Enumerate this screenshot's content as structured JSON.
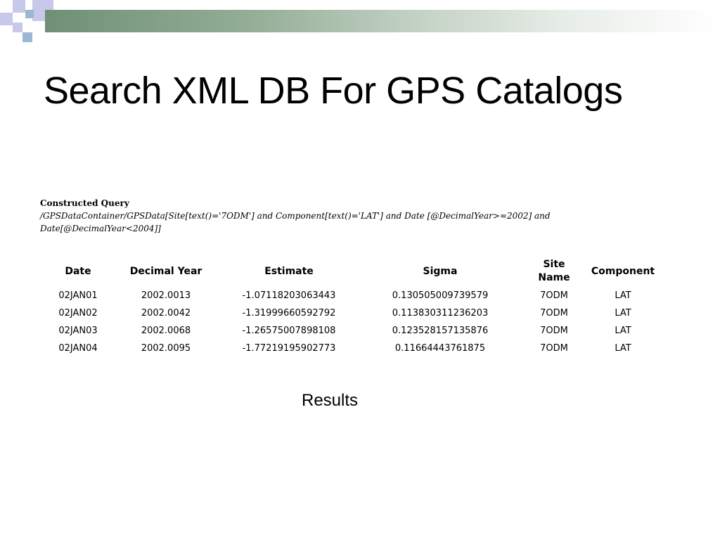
{
  "slide": {
    "title": "Search XML DB For GPS Catalogs",
    "caption": "Results"
  },
  "query": {
    "heading": "Constructed Query",
    "text": "/GPSDataContainer/GPSData[Site[text()='7ODM'] and Component[text()='LAT'] and Date [@DecimalYear>=2002] and Date[@DecimalYear<2004]]"
  },
  "table": {
    "headers": {
      "date": "Date",
      "decimal_year": "Decimal Year",
      "estimate": "Estimate",
      "sigma": "Sigma",
      "site_line1": "Site",
      "site_line2": "Name",
      "component": "Component"
    },
    "rows": [
      {
        "date": "02JAN01",
        "decimal_year": "2002.0013",
        "estimate": "-1.07118203063443",
        "sigma": "0.130505009739579",
        "site": "7ODM",
        "component": "LAT"
      },
      {
        "date": "02JAN02",
        "decimal_year": "2002.0042",
        "estimate": "-1.31999660592792",
        "sigma": "0.113830311236203",
        "site": "7ODM",
        "component": "LAT"
      },
      {
        "date": "02JAN03",
        "decimal_year": "2002.0068",
        "estimate": "-1.26575007898108",
        "sigma": "0.123528157135876",
        "site": "7ODM",
        "component": "LAT"
      },
      {
        "date": "02JAN04",
        "decimal_year": "2002.0095",
        "estimate": "-1.77219195902773",
        "sigma": "0.11664443761875",
        "site": "7ODM",
        "component": "LAT"
      }
    ]
  },
  "colors": {
    "bar_start": "#6f9075",
    "square_lavender": "#c8c8ea",
    "square_blue": "#9db6d2"
  }
}
